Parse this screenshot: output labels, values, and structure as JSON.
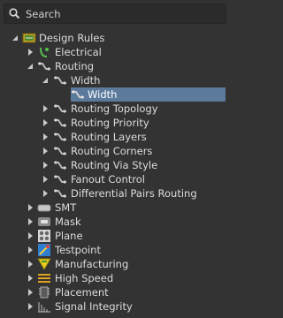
{
  "search": {
    "placeholder": "Search"
  },
  "tree": {
    "design_rules": "Design Rules",
    "electrical": "Electrical",
    "routing": "Routing",
    "width_group": "Width",
    "width_rule": "Width",
    "routing_topology": "Routing Topology",
    "routing_priority": "Routing Priority",
    "routing_layers": "Routing Layers",
    "routing_corners": "Routing Corners",
    "routing_via_style": "Routing Via Style",
    "fanout_control": "Fanout Control",
    "differential_pairs_routing": "Differential Pairs Routing",
    "smt": "SMT",
    "mask": "Mask",
    "plane": "Plane",
    "testpoint": "Testpoint",
    "manufacturing": "Manufacturing",
    "high_speed": "High Speed",
    "placement": "Placement",
    "signal_integrity": "Signal Integrity"
  },
  "colors": {
    "background": "#333333",
    "selection": "#5c7a9c",
    "text": "#dcdcdc"
  }
}
